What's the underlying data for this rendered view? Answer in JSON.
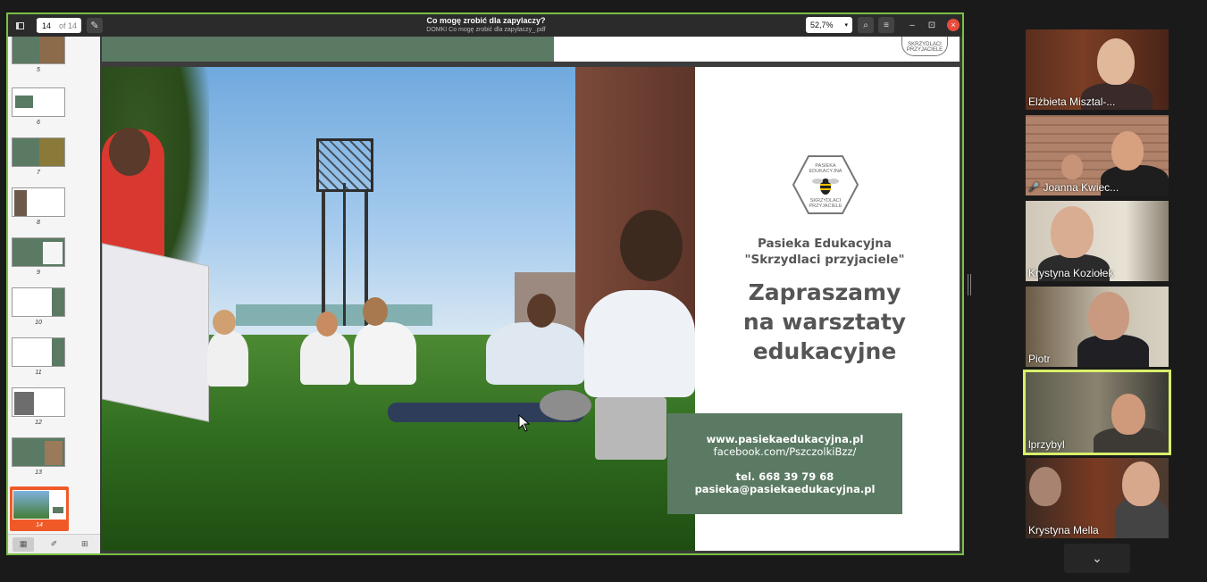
{
  "viewer": {
    "current_page": "14",
    "page_of": "of 14",
    "title": "Co mogę zrobić dla zapylaczy?",
    "subtitle": "DOMKI Co mogę zrobić dla zapylaczy_.pdf",
    "zoom": "52,7%",
    "accent_color": "#f05a28",
    "share_border_color": "#7ac143"
  },
  "thumbnails": [
    {
      "num": "5"
    },
    {
      "num": "6"
    },
    {
      "num": "7"
    },
    {
      "num": "8"
    },
    {
      "num": "9"
    },
    {
      "num": "10"
    },
    {
      "num": "11"
    },
    {
      "num": "12"
    },
    {
      "num": "13"
    },
    {
      "num": "14",
      "active": true
    }
  ],
  "slide": {
    "logo_top": "PASIEKA\nEDUKACYJNA",
    "logo_bottom": "SKRZYDLACI\nPRZYJACIELE",
    "logo_partial": "SKRZYDLACI\nPRZYJACIELE",
    "org_line1": "Pasieka Edukacyjna",
    "org_line2": "\"Skrzydlaci przyjaciele\"",
    "headline_line1": "Zapraszamy",
    "headline_line2": "na warsztaty",
    "headline_line3": "edukacyjne",
    "website": "www.pasiekaedukacyjna.pl",
    "facebook": "facebook.com/PszczolkiBzz/",
    "phone": "tel. 668 39 79 68",
    "email": "pasieka@pasiekaedukacyjna.pl",
    "panel_color": "#5b7a63"
  },
  "participants": [
    {
      "name": "Elżbieta Misztal-...",
      "muted": false
    },
    {
      "name": "Joanna Kwiec...",
      "muted": true
    },
    {
      "name": "Krystyna Koziołek",
      "muted": false
    },
    {
      "name": "Piotr",
      "muted": false
    },
    {
      "name": "lprzybyl",
      "muted": false,
      "speaking": true
    },
    {
      "name": "Krystyna Mella",
      "muted": false
    }
  ],
  "icons": {
    "sidebar_toggle": "sidebar-icon",
    "annotate": "pen-icon",
    "search": "search-icon",
    "menu": "hamburger-icon",
    "minimize": "minimize-icon",
    "maximize": "maximize-icon",
    "close": "close-icon",
    "scroll_down": "chevron-down-icon"
  },
  "glyphs": {
    "caret": "▾",
    "pen": "✎",
    "search": "⌕",
    "menu": "≡",
    "minimize": "–",
    "maximize": "⊡",
    "close": "×",
    "grid": "▦",
    "annotations": "✐",
    "outline": "⊞",
    "chevron": "⌄",
    "mic_muted": "🎤"
  }
}
